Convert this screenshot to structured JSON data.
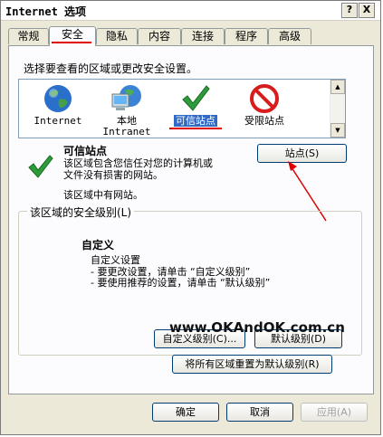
{
  "window": {
    "title": "Internet 选项",
    "help_button": "?",
    "close_button": "X"
  },
  "tabs": [
    {
      "label": "常规"
    },
    {
      "label": "安全"
    },
    {
      "label": "隐私"
    },
    {
      "label": "内容"
    },
    {
      "label": "连接"
    },
    {
      "label": "程序"
    },
    {
      "label": "高级"
    }
  ],
  "security": {
    "instruction": "选择要查看的区域或更改安全设置。",
    "zones": [
      {
        "line1": "Internet",
        "line2": "",
        "icon": "globe-icon"
      },
      {
        "line1": "本地",
        "line2": "Intranet",
        "icon": "computer-network-icon"
      },
      {
        "line1": "可信站点",
        "line2": "",
        "icon": "checkmark-icon"
      },
      {
        "line1": "受限站点",
        "line2": "",
        "icon": "prohibited-icon"
      }
    ],
    "selected_zone": {
      "title": "可信站点",
      "desc_line1": "该区域包含您信任对您的计算机或",
      "desc_line2": "文件没有损害的网站。",
      "note": "该区域中有网站。"
    },
    "sites_button": "站点(S)",
    "level_group": {
      "legend": "该区域的安全级别(L)",
      "level_title": "自定义",
      "line1": "自定义设置",
      "line2": "- 要更改设置，请单击 “自定义级别”",
      "line3": "- 要使用推荐的设置，请单击 “默认级别”"
    },
    "custom_level_button": "自定义级别(C)...",
    "default_level_button": "默认级别(D)",
    "reset_all_button": "将所有区域重置为默认级别(R)"
  },
  "watermark": "www.OKAndOK.com.cn",
  "footer": {
    "ok": "确定",
    "cancel": "取消",
    "apply": "应用(A)"
  },
  "colors": {
    "annotation_red": "#e00000",
    "selection_blue": "#316ac5",
    "check_green": "#2e9b3a"
  }
}
